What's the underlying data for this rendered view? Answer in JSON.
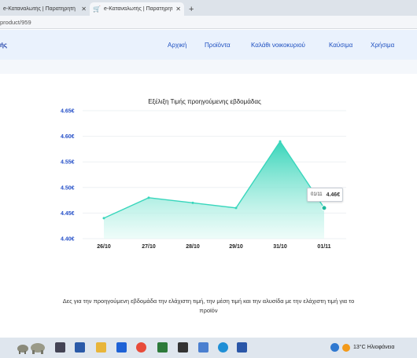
{
  "browser": {
    "tabs": [
      {
        "label": "e-Καταναλωτής | Παρατηρητή"
      },
      {
        "label": "e-Καταναλωτής | Παρατηρητή"
      }
    ],
    "address": "product/959"
  },
  "nav": {
    "brand": "ής",
    "items": [
      "Αρχική",
      "Προϊόντα",
      "Καλάθι νοικοκυριού",
      "Καύσιμα",
      "Χρήσιμα"
    ]
  },
  "tooltip": {
    "date": "01/11",
    "price": "4.46€"
  },
  "caption": "Δες για την προηγούμενη εβδομάδα την ελάχιστη τιμή, την μέση τιμή και την αλυσίδα με την ελάχιστη τιμή για το προϊόν",
  "taskbar": {
    "weather": "13°C Ηλιοφάνεια"
  },
  "colors": {
    "accent": "#1d4fc0",
    "series": "#38d6bc"
  },
  "chart_data": {
    "type": "area",
    "title": "Εξέλιξη Τιμής προηγούμενης εβδομάδας",
    "categories": [
      "26/10",
      "27/10",
      "28/10",
      "29/10",
      "31/10",
      "01/11"
    ],
    "values": [
      4.44,
      4.48,
      4.47,
      4.46,
      4.59,
      4.46
    ],
    "yticks": [
      "4.40€",
      "4.45€",
      "4.50€",
      "4.55€",
      "4.60€",
      "4.65€"
    ],
    "ylim": [
      4.4,
      4.65
    ],
    "grid": true,
    "xlabel": "",
    "ylabel": ""
  }
}
